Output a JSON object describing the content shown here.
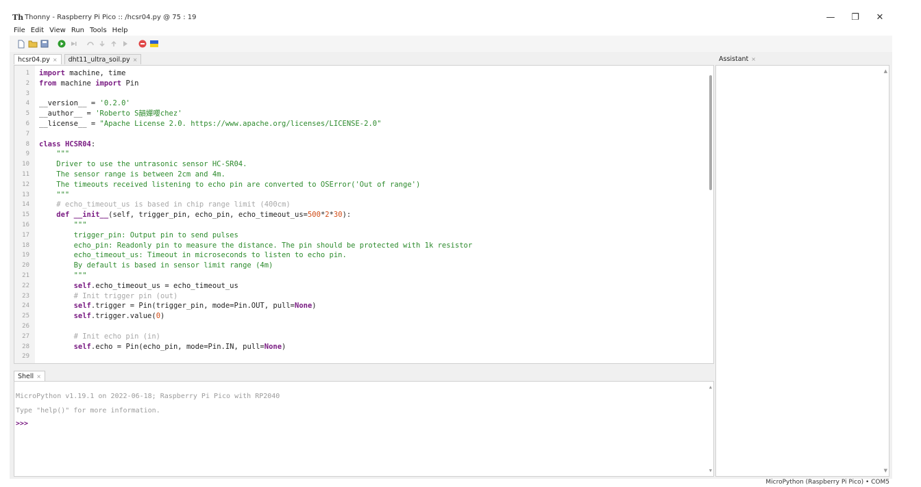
{
  "window": {
    "app_logo": "Th",
    "title": "Thonny - Raspberry Pi Pico :: /hcsr04.py @ 75 : 19",
    "minimize": "—",
    "restore": "❐",
    "close": "✕"
  },
  "menu": [
    "File",
    "Edit",
    "View",
    "Run",
    "Tools",
    "Help"
  ],
  "editor_tabs": [
    {
      "label": "hcsr04.py",
      "active": true
    },
    {
      "label": "dht11_ultra_soil.py",
      "active": false
    }
  ],
  "tab_close": "×",
  "code_lines": [
    [
      {
        "t": "import",
        "c": "kw"
      },
      {
        "t": " machine, time"
      }
    ],
    [
      {
        "t": "from",
        "c": "kw"
      },
      {
        "t": " machine "
      },
      {
        "t": "import",
        "c": "kw"
      },
      {
        "t": " Pin"
      }
    ],
    [],
    [
      {
        "t": "__version__ = "
      },
      {
        "t": "'0.2.0'",
        "c": "str"
      }
    ],
    [
      {
        "t": "__author__ = "
      },
      {
        "t": "'Roberto S韻嬋嚶chez'",
        "c": "str"
      }
    ],
    [
      {
        "t": "__license__ = "
      },
      {
        "t": "\"Apache License 2.0. https://www.apache.org/licenses/LICENSE-2.0\"",
        "c": "str"
      }
    ],
    [],
    [
      {
        "t": "class",
        "c": "kw"
      },
      {
        "t": " "
      },
      {
        "t": "HCSR04",
        "c": "kw"
      },
      {
        "t": ":"
      }
    ],
    [
      {
        "t": "    \"\"\"",
        "c": "str"
      }
    ],
    [
      {
        "t": "    Driver to use the untrasonic sensor HC-SR04.",
        "c": "str"
      }
    ],
    [
      {
        "t": "    The sensor range is between 2cm and 4m.",
        "c": "str"
      }
    ],
    [
      {
        "t": "    The timeouts received listening to echo pin are converted to OSError('Out of range')",
        "c": "str"
      }
    ],
    [
      {
        "t": "    \"\"\"",
        "c": "str"
      }
    ],
    [
      {
        "t": "    # echo_timeout_us is based in chip range limit (400cm)",
        "c": "cmt"
      }
    ],
    [
      {
        "t": "    "
      },
      {
        "t": "def",
        "c": "kw"
      },
      {
        "t": " "
      },
      {
        "t": "__init__",
        "c": "kw"
      },
      {
        "t": "(self, trigger_pin, echo_pin, echo_timeout_us="
      },
      {
        "t": "500",
        "c": "num"
      },
      {
        "t": "*"
      },
      {
        "t": "2",
        "c": "num"
      },
      {
        "t": "*"
      },
      {
        "t": "30",
        "c": "num"
      },
      {
        "t": "):"
      }
    ],
    [
      {
        "t": "        \"\"\"",
        "c": "str"
      }
    ],
    [
      {
        "t": "        trigger_pin: Output pin to send pulses",
        "c": "str"
      }
    ],
    [
      {
        "t": "        echo_pin: Readonly pin to measure the distance. The pin should be protected with 1k resistor",
        "c": "str"
      }
    ],
    [
      {
        "t": "        echo_timeout_us: Timeout in microseconds to listen to echo pin.",
        "c": "str"
      }
    ],
    [
      {
        "t": "        By default is based in sensor limit range (4m)",
        "c": "str"
      }
    ],
    [
      {
        "t": "        \"\"\"",
        "c": "str"
      }
    ],
    [
      {
        "t": "        "
      },
      {
        "t": "self",
        "c": "kw"
      },
      {
        "t": ".echo_timeout_us = echo_timeout_us"
      }
    ],
    [
      {
        "t": "        # Init trigger pin (out)",
        "c": "cmt"
      }
    ],
    [
      {
        "t": "        "
      },
      {
        "t": "self",
        "c": "kw"
      },
      {
        "t": ".trigger = Pin(trigger_pin, mode=Pin.OUT, pull="
      },
      {
        "t": "None",
        "c": "kw"
      },
      {
        "t": ")"
      }
    ],
    [
      {
        "t": "        "
      },
      {
        "t": "self",
        "c": "kw"
      },
      {
        "t": ".trigger.value("
      },
      {
        "t": "0",
        "c": "num"
      },
      {
        "t": ")"
      }
    ],
    [],
    [
      {
        "t": "        # Init echo pin (in)",
        "c": "cmt"
      }
    ],
    [
      {
        "t": "        "
      },
      {
        "t": "self",
        "c": "kw"
      },
      {
        "t": ".echo = Pin(echo_pin, mode=Pin.IN, pull="
      },
      {
        "t": "None",
        "c": "kw"
      },
      {
        "t": ")"
      }
    ],
    []
  ],
  "shell": {
    "tab_label": "Shell",
    "info1": "MicroPython v1.19.1 on 2022-06-18; Raspberry Pi Pico with RP2040",
    "info2": "Type \"help()\" for more information.",
    "prompt": ">>>"
  },
  "assistant": {
    "tab_label": "Assistant"
  },
  "scroll": {
    "up": "▲",
    "down": "▼"
  },
  "status": "MicroPython (Raspberry Pi Pico) • COM5",
  "colors": {
    "keyword": "#7a1c83",
    "string": "#2c8a2c",
    "number": "#d04a14",
    "comment": "#a8a8a8",
    "run_icon": "#2e9c2e",
    "stop_icon": "#e04848"
  }
}
